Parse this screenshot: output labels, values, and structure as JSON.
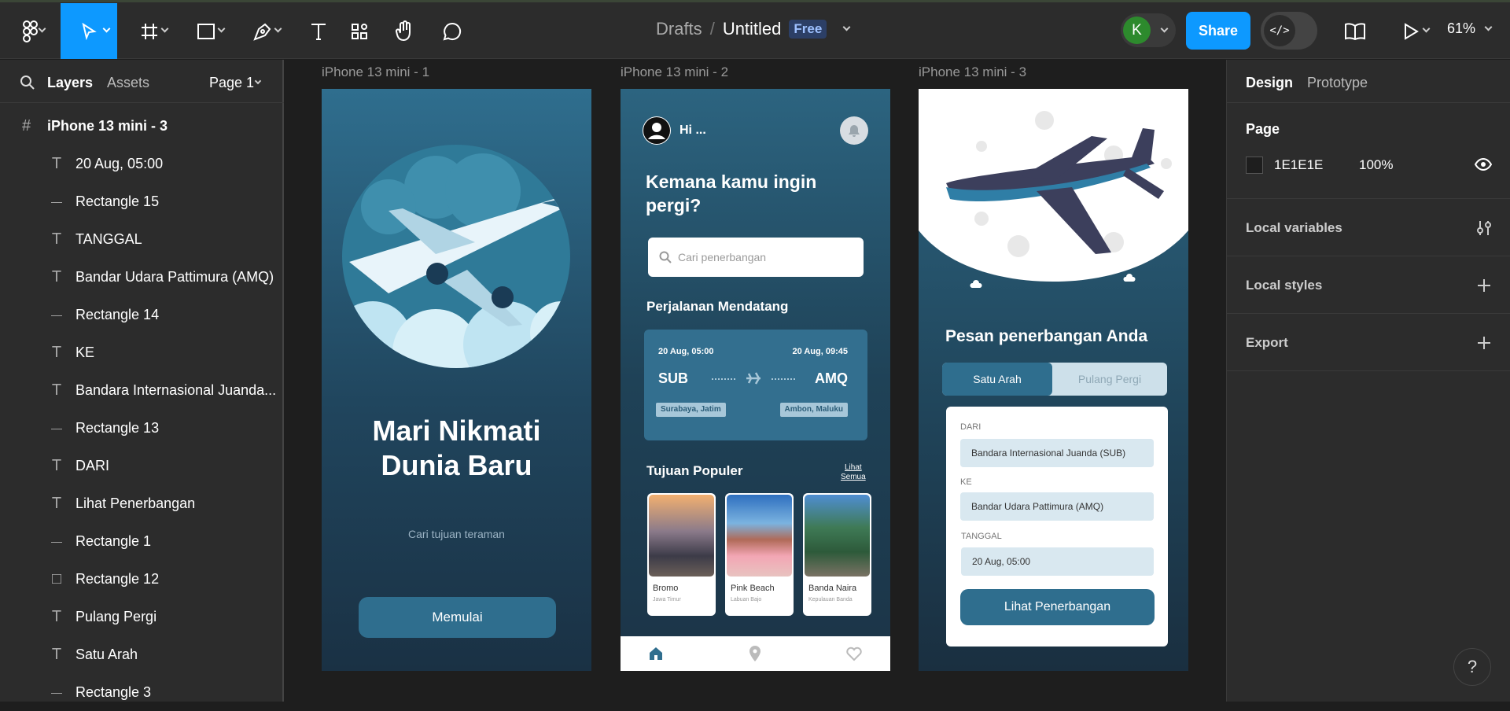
{
  "header": {
    "breadcrumb_parent": "Drafts",
    "breadcrumb_sep": "/",
    "file_name": "Untitled",
    "plan_badge": "Free",
    "avatar_letter": "K",
    "share_label": "Share",
    "dev_mode_glyph": "</>",
    "zoom": "61%"
  },
  "left_panel": {
    "tabs": [
      "Layers",
      "Assets"
    ],
    "page_selector": "Page 1",
    "root_frame": "iPhone 13 mini - 3",
    "layers": [
      {
        "icon": "text",
        "name": "20 Aug, 05:00"
      },
      {
        "icon": "line",
        "name": "Rectangle 15"
      },
      {
        "icon": "text",
        "name": "TANGGAL"
      },
      {
        "icon": "text",
        "name": "Bandar Udara Pattimura (AMQ)"
      },
      {
        "icon": "line",
        "name": "Rectangle 14"
      },
      {
        "icon": "text",
        "name": "KE"
      },
      {
        "icon": "text",
        "name": "Bandara Internasional Juanda..."
      },
      {
        "icon": "line",
        "name": "Rectangle 13"
      },
      {
        "icon": "text",
        "name": "DARI"
      },
      {
        "icon": "text",
        "name": "Lihat Penerbangan"
      },
      {
        "icon": "line",
        "name": "Rectangle 1"
      },
      {
        "icon": "rect",
        "name": "Rectangle 12"
      },
      {
        "icon": "text",
        "name": "Pulang Pergi"
      },
      {
        "icon": "text",
        "name": "Satu Arah"
      },
      {
        "icon": "line",
        "name": "Rectangle 3"
      }
    ]
  },
  "canvas": {
    "frames": [
      "iPhone 13 mini - 1",
      "iPhone 13 mini - 2",
      "iPhone 13 mini - 3"
    ],
    "frame1": {
      "headline_line1": "Mari Nikmati",
      "headline_line2": "Dunia Baru",
      "subtitle": "Cari tujuan teraman",
      "cta": "Memulai"
    },
    "frame2": {
      "greeting": "Hi ...",
      "title_line1": "Kemana kamu ingin",
      "title_line2": "pergi?",
      "search_placeholder": "Cari penerbangan",
      "upcoming_title": "Perjalanan Mendatang",
      "trip": {
        "depart_time": "20 Aug, 05:00",
        "arrive_time": "20 Aug, 09:45",
        "from_code": "SUB",
        "to_code": "AMQ",
        "from_city": "Surabaya, Jatim",
        "to_city": "Ambon, Maluku"
      },
      "popular_title": "Tujuan Populer",
      "see_all_line1": "Lihat",
      "see_all_line2": "Semua",
      "destinations": [
        {
          "name": "Bromo",
          "region": "Jawa Timur"
        },
        {
          "name": "Pink Beach",
          "region": "Labuan Bajo"
        },
        {
          "name": "Banda Naira",
          "region": "Kepulauan Banda"
        }
      ]
    },
    "frame3": {
      "title": "Pesan penerbangan Anda",
      "tab_active": "Satu Arah",
      "tab_inactive": "Pulang Pergi",
      "from_label": "DARI",
      "from_value": "Bandara Internasional Juanda (SUB)",
      "to_label": "KE",
      "to_value": "Bandar Udara Pattimura (AMQ)",
      "date_label": "TANGGAL",
      "date_value": "20 Aug, 05:00",
      "cta": "Lihat Penerbangan"
    }
  },
  "right_panel": {
    "tabs": [
      "Design",
      "Prototype"
    ],
    "page_heading": "Page",
    "bg_color": "1E1E1E",
    "bg_opacity": "100%",
    "sections": [
      "Local variables",
      "Local styles",
      "Export"
    ]
  },
  "help_glyph": "?",
  "colors": {
    "accent": "#0d99ff",
    "teal": "#2f6e8e",
    "canvas": "#1e1e1e"
  }
}
